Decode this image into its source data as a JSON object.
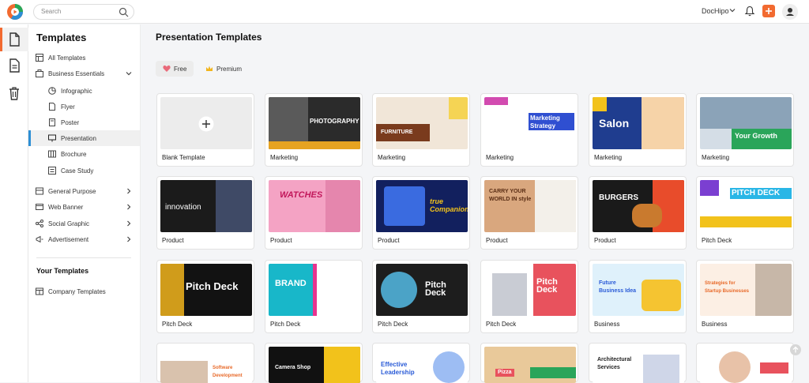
{
  "topbar": {
    "search_placeholder": "Search",
    "brand_name": "DocHipo"
  },
  "colors": {
    "accent": "#f26a30",
    "selected_bar": "#2d8fd5"
  },
  "sidebar": {
    "title": "Templates",
    "items": [
      {
        "label": "All Templates",
        "icon": "grid-icon"
      },
      {
        "label": "Business Essentials",
        "icon": "briefcase-icon"
      },
      {
        "label": "Infographic",
        "icon": "chart-icon"
      },
      {
        "label": "Flyer",
        "icon": "flyer-icon"
      },
      {
        "label": "Poster",
        "icon": "poster-icon"
      },
      {
        "label": "Presentation",
        "icon": "presentation-icon"
      },
      {
        "label": "Brochure",
        "icon": "brochure-icon"
      },
      {
        "label": "Case Study",
        "icon": "case-study-icon"
      },
      {
        "label": "General Purpose",
        "icon": "general-icon"
      },
      {
        "label": "Web Banner",
        "icon": "banner-icon"
      },
      {
        "label": "Social Graphic",
        "icon": "social-icon"
      },
      {
        "label": "Advertisement",
        "icon": "ad-icon"
      }
    ],
    "your_templates_title": "Your Templates",
    "company_templates": "Company Templates"
  },
  "main": {
    "title": "Presentation Templates",
    "filters": {
      "free": "Free",
      "premium": "Premium"
    },
    "cards": [
      {
        "caption": "Blank Template"
      },
      {
        "caption": "Marketing",
        "text": "PHOTOGRAPHY"
      },
      {
        "caption": "Marketing",
        "text": "FURNITURE"
      },
      {
        "caption": "Marketing",
        "text": "Marketing Strategy"
      },
      {
        "caption": "Marketing",
        "text": "Salon"
      },
      {
        "caption": "Marketing",
        "text": "Your Growth"
      },
      {
        "caption": "Product",
        "text": "innovation"
      },
      {
        "caption": "Product",
        "text": "WATCHES"
      },
      {
        "caption": "Product",
        "text": "true Companion"
      },
      {
        "caption": "Product",
        "text": "CARRY YOUR WORLD IN style"
      },
      {
        "caption": "Product",
        "text": "BURGERS"
      },
      {
        "caption": "Pitch Deck",
        "text": "PITCH DECK"
      },
      {
        "caption": "Pitch Deck",
        "text": "Pitch Deck"
      },
      {
        "caption": "Pitch Deck",
        "text": "BRAND"
      },
      {
        "caption": "Pitch Deck",
        "text": "Pitch Deck"
      },
      {
        "caption": "Pitch Deck",
        "text": "Pitch Deck"
      },
      {
        "caption": "Business",
        "text": "Future Business Idea"
      },
      {
        "caption": "Business",
        "text": "Strategies for Startup Businesses"
      },
      {
        "caption": "",
        "text": "Software Development"
      },
      {
        "caption": "",
        "text": "Camera Shop"
      },
      {
        "caption": "",
        "text": "Effective Leadership"
      },
      {
        "caption": "",
        "text": "Pizza"
      },
      {
        "caption": "",
        "text": "Architectural Services"
      },
      {
        "caption": "",
        "text": ""
      }
    ]
  }
}
